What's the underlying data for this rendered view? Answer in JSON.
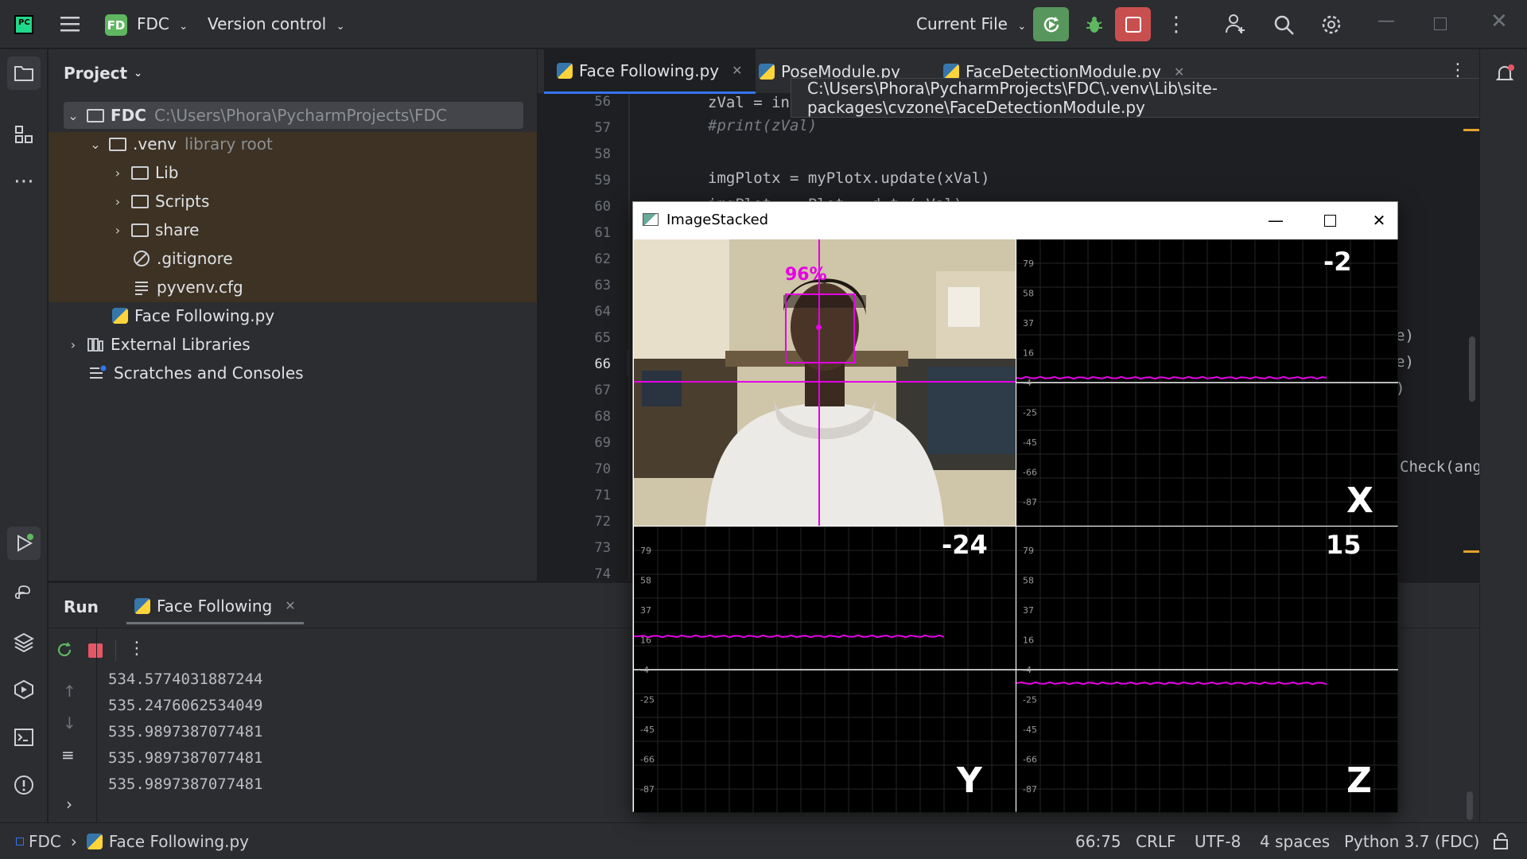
{
  "titlebar": {
    "project_badge": "FD",
    "project_name": "FDC",
    "vcs": "Version control",
    "run_config": "Current File"
  },
  "project_panel": {
    "title": "Project",
    "tree": [
      {
        "label": "FDC",
        "muted": "C:\\Users\\Phora\\PycharmProjects\\FDC",
        "kind": "folder",
        "expanded": true
      },
      {
        "label": ".venv",
        "muted": "library root",
        "kind": "folder",
        "expanded": true
      },
      {
        "label": "Lib",
        "muted": "",
        "kind": "folder"
      },
      {
        "label": "Scripts",
        "muted": "",
        "kind": "folder"
      },
      {
        "label": "share",
        "muted": "",
        "kind": "folder"
      },
      {
        "label": ".gitignore",
        "muted": "",
        "kind": "ignore-file"
      },
      {
        "label": "pyvenv.cfg",
        "muted": "",
        "kind": "text-file"
      },
      {
        "label": "Face Following.py",
        "muted": "",
        "kind": "python-file"
      },
      {
        "label": "External Libraries",
        "muted": "",
        "kind": "library"
      },
      {
        "label": "Scratches and Consoles",
        "muted": "",
        "kind": "scratches"
      }
    ]
  },
  "editor": {
    "tabs": [
      {
        "label": "Face Following.py",
        "active": true
      },
      {
        "label": "PoseModule.py",
        "active": false
      },
      {
        "label": "FaceDetectionModule.py",
        "active": false
      }
    ],
    "tooltip": "C:\\Users\\Phora\\PycharmProjects\\FDC\\.venv\\Lib\\site-packages\\cvzone\\FaceDetectionModule.py",
    "line_numbers": [
      "56",
      "57",
      "58",
      "59",
      "60",
      "61",
      "62",
      "63",
      "64",
      "65",
      "66",
      "67",
      "68",
      "69",
      "70",
      "71",
      "72",
      "73",
      "74"
    ],
    "current_line": "66",
    "code": {
      "l56": "zVal = in",
      "l57": "#print(zVal)",
      "l59": "imgPlotx = myPlotx.update(xVal)",
      "l60": "imgPlot    Plot   d t ( Val)",
      "l65": "e)",
      "l66": "e)",
      "l67": ")",
      "l70": "Check(ang"
    }
  },
  "run_panel": {
    "title": "Run",
    "tab": "Face Following",
    "output": [
      "534.5774031887244",
      "535.2476062534049",
      "535.9897387077481",
      "535.9897387077481",
      "535.9897387077481"
    ]
  },
  "status_bar": {
    "breadcrumb_root": "FDC",
    "breadcrumb_file": "Face Following.py",
    "position": "66:75",
    "line_sep": "CRLF",
    "encoding": "UTF-8",
    "indent": "4 spaces",
    "interpreter": "Python 3.7 (FDC)"
  },
  "image_window": {
    "title": "ImageStacked",
    "face_confidence": "96%",
    "plots": [
      {
        "name": "X",
        "value": "-2",
        "ticks": [
          "79",
          "58",
          "37",
          "16",
          "-4",
          "-25",
          "-45",
          "-66",
          "-87"
        ]
      },
      {
        "name": "Y",
        "value": "-24",
        "ticks": [
          "79",
          "58",
          "37",
          "16",
          "-4",
          "-25",
          "-45",
          "-66",
          "-87"
        ]
      },
      {
        "name": "Z",
        "value": "15",
        "ticks": [
          "79",
          "58",
          "37",
          "16",
          "-4",
          "-25",
          "-45",
          "-66",
          "-87"
        ]
      }
    ],
    "accent": "#e600e6"
  }
}
